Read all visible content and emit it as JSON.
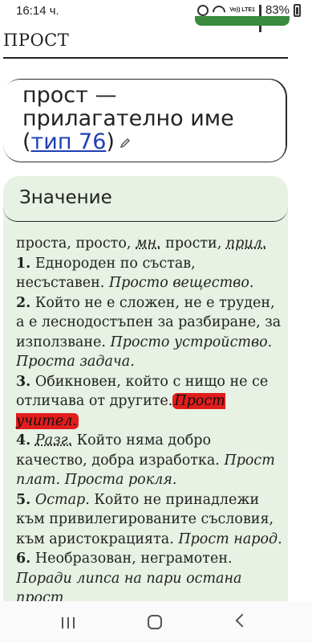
{
  "status_bar": {
    "time": "16:14 ч.",
    "volte": "Vo))\nLTE1",
    "battery": "83%"
  },
  "page": {
    "title": "ПРОСТ"
  },
  "headword": {
    "word_line1": "прост —",
    "word_line2": "прилагателно име",
    "type_open": "(",
    "type_link": "тип 76",
    "type_close": ")"
  },
  "meaning": {
    "heading": "Значение",
    "forms_pre": "проста, просто, ",
    "forms_abbr1": "мн.",
    "forms_mid": " прости, ",
    "forms_abbr2": "прил.",
    "s1_num": "1.",
    "s1_text": " Еднороден по състав, несъставен. ",
    "s1_ex": "Просто вещество.",
    "s2_num": "2.",
    "s2_text": " Който не е сложен, не е труден, а е леснодостъпен за разбиране, за използване. ",
    "s2_ex": "Просто устройство. Проста задача.",
    "s3_num": "3.",
    "s3_text": " Обикновен, който с нищо не се отличава от другите.",
    "s3_ex": "Прост учител.",
    "s4_num": "4.",
    "s4_abbr": "Разг.",
    "s4_text": " Който няма добро качество, добра изработка. ",
    "s4_ex": "Прост плат. Проста рокля.",
    "s5_num": "5.",
    "s5_abbr": "Остар.",
    "s5_text": " Който не принадлежи към привилегированите съсловия, към аристокрацията. ",
    "s5_ex": "Прост народ.",
    "s6_num": "6.",
    "s6_text": " Необразован, неграмотен. ",
    "s6_ex": "Поради липса на пари остана прост"
  }
}
